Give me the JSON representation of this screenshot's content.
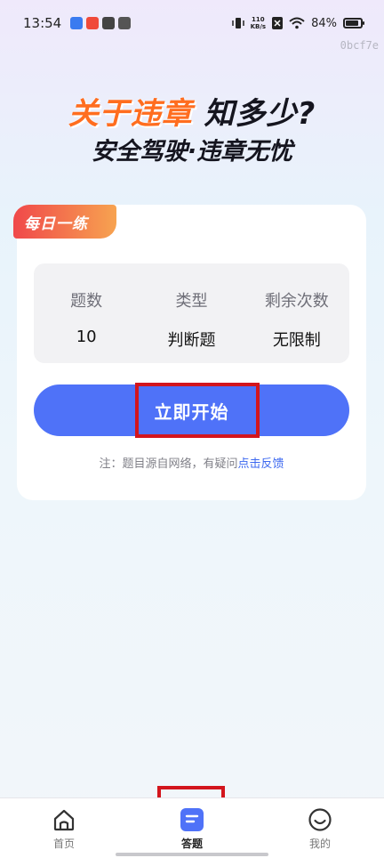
{
  "status": {
    "time": "13:54",
    "net_speed_value": "110",
    "net_speed_unit": "KB/s",
    "battery": "84%"
  },
  "device_id": "0bcf7e",
  "banner": {
    "line1_orange": "关于违章",
    "line1_dark": "知多少?",
    "line2": "安全驾驶·违章无忧"
  },
  "card": {
    "ribbon": "每日一练",
    "info": [
      {
        "label": "题数",
        "value": "10"
      },
      {
        "label": "类型",
        "value": "判断题"
      },
      {
        "label": "剩余次数",
        "value": "无限制"
      }
    ],
    "start_button": "立即开始",
    "note_prefix": "注：题目源自网络，有疑问",
    "note_link": "点击反馈"
  },
  "tabbar": {
    "items": [
      {
        "label": "首页",
        "icon": "home-icon"
      },
      {
        "label": "答题",
        "icon": "quiz-icon"
      },
      {
        "label": "我的",
        "icon": "smile-icon"
      }
    ]
  },
  "colors": {
    "accent": "#4f72f8",
    "ribbon_start": "#f0484a",
    "ribbon_end": "#f7a350",
    "highlight": "#d3151c"
  }
}
